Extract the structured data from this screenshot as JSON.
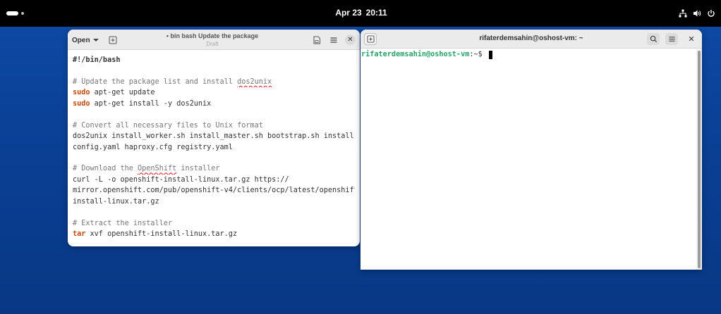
{
  "topbar": {
    "date": "Apr 23",
    "time": "20:11",
    "icons": [
      "network-icon",
      "volume-icon",
      "power-icon"
    ]
  },
  "editor": {
    "open_label": "Open",
    "title": "• bin bash Update the package",
    "subtitle": "Draft",
    "lines": [
      [
        {
          "t": "#!/bin/bash",
          "c": "shebang"
        }
      ],
      [],
      [
        {
          "t": "# Update the package list and install ",
          "c": "cmt"
        },
        {
          "t": "dos2unix",
          "c": "cmt spell"
        }
      ],
      [
        {
          "t": "sudo",
          "c": "kw"
        },
        {
          "t": " apt-get update",
          "c": ""
        }
      ],
      [
        {
          "t": "sudo",
          "c": "kw"
        },
        {
          "t": " apt-get install -y dos2unix",
          "c": ""
        }
      ],
      [],
      [
        {
          "t": "# Convert all necessary files to Unix format",
          "c": "cmt"
        }
      ],
      [
        {
          "t": "dos2unix install_worker.sh install_master.sh bootstrap.sh install-",
          "c": ""
        }
      ],
      [
        {
          "t": "config.yaml haproxy.cfg registry.yaml",
          "c": ""
        }
      ],
      [],
      [
        {
          "t": "# Download the ",
          "c": "cmt"
        },
        {
          "t": "OpenShift",
          "c": "cmt spell"
        },
        {
          "t": " installer",
          "c": "cmt"
        }
      ],
      [
        {
          "t": "curl -L -o openshift-install-linux.tar.gz https://",
          "c": ""
        }
      ],
      [
        {
          "t": "mirror.openshift.com/pub/openshift-v4/clients/ocp/latest/openshift-",
          "c": ""
        }
      ],
      [
        {
          "t": "install-linux.tar.gz",
          "c": ""
        }
      ],
      [],
      [
        {
          "t": "# Extract the installer",
          "c": "cmt"
        }
      ],
      [
        {
          "t": "tar",
          "c": "kw"
        },
        {
          "t": " xvf openshift-install-linux.tar.gz",
          "c": ""
        }
      ]
    ]
  },
  "terminal": {
    "title": "rifaterdemsahin@oshost-vm: ~",
    "prompt_user": "rifaterdemsahin@oshost-vm",
    "prompt_path": ":~$ "
  }
}
